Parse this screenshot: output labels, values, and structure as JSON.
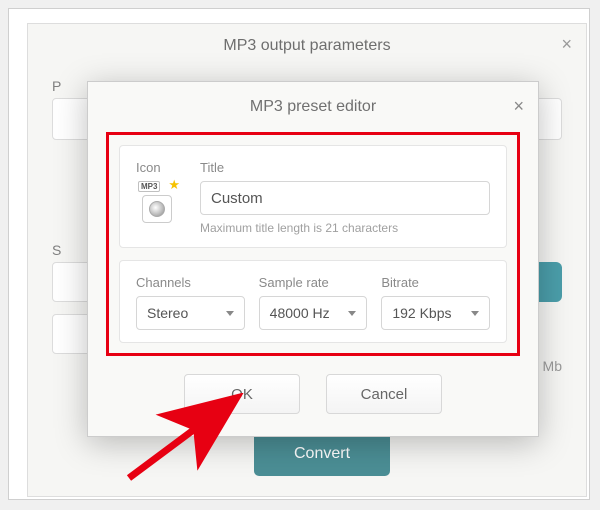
{
  "outer_dialog": {
    "title": "MP3 output parameters",
    "labels": {
      "p": "P",
      "s": "S"
    },
    "mb": "Mb",
    "convert_label": "Convert"
  },
  "modal": {
    "title": "MP3 preset editor",
    "icon_label": "Icon",
    "icon_tag": "MP3",
    "title_label": "Title",
    "title_value": "Custom",
    "title_hint": "Maximum title length is 21 characters",
    "channels_label": "Channels",
    "channels_value": "Stereo",
    "samplerate_label": "Sample rate",
    "samplerate_value": "48000 Hz",
    "bitrate_label": "Bitrate",
    "bitrate_value": "192 Kbps",
    "ok_label": "OK",
    "cancel_label": "Cancel"
  }
}
